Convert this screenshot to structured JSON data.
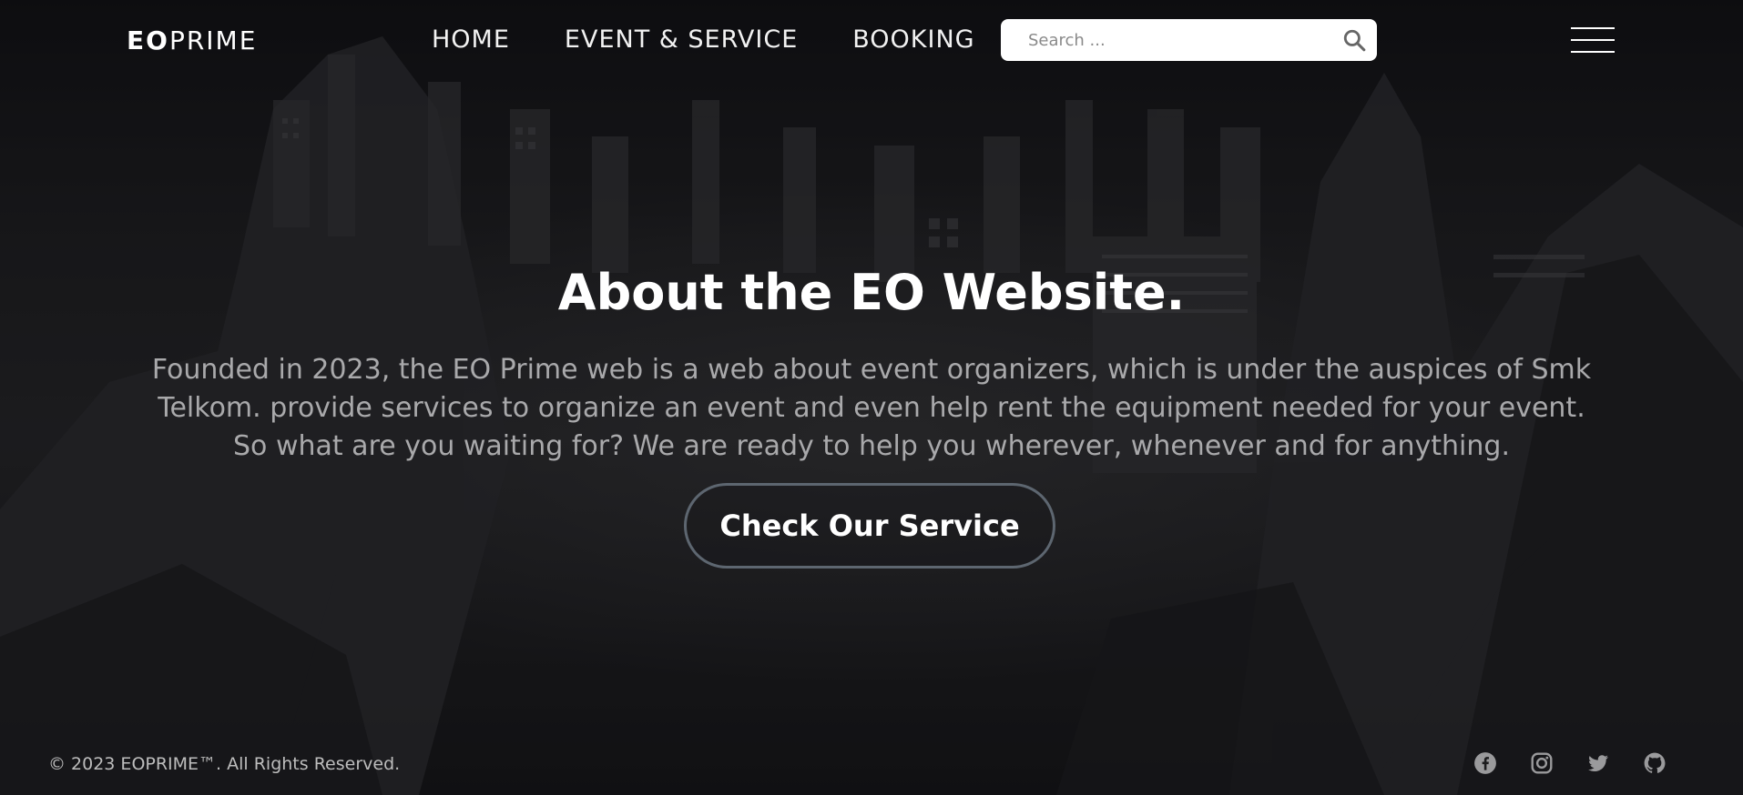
{
  "brand": {
    "bold": "EO",
    "light": "PRIME"
  },
  "nav": {
    "items": [
      {
        "label": "HOME"
      },
      {
        "label": "EVENT & SERVICE"
      },
      {
        "label": "BOOKING"
      }
    ]
  },
  "search": {
    "placeholder": "Search ...",
    "value": "",
    "icon": "search-icon"
  },
  "menu_icon": "hamburger-menu-icon",
  "hero": {
    "title": "About the EO Website.",
    "text": "Founded in 2023, the EO Prime web is a web about event organizers, which is under the auspices of Smk Telkom. provide services to organize an event and even help rent the equipment needed for your event. So what are you waiting for? We are ready to help you wherever, whenever and for anything.",
    "cta_label": "Check Our Service"
  },
  "footer": {
    "copyright": "© 2023 EOPRIME™. All Rights Reserved.",
    "socials": [
      "facebook-icon",
      "instagram-icon",
      "twitter-icon",
      "github-icon"
    ]
  },
  "colors": {
    "text": "#ffffff",
    "muted": "#a9a9ab",
    "button_border": "#5d6670",
    "background": "#1c1c1e"
  }
}
